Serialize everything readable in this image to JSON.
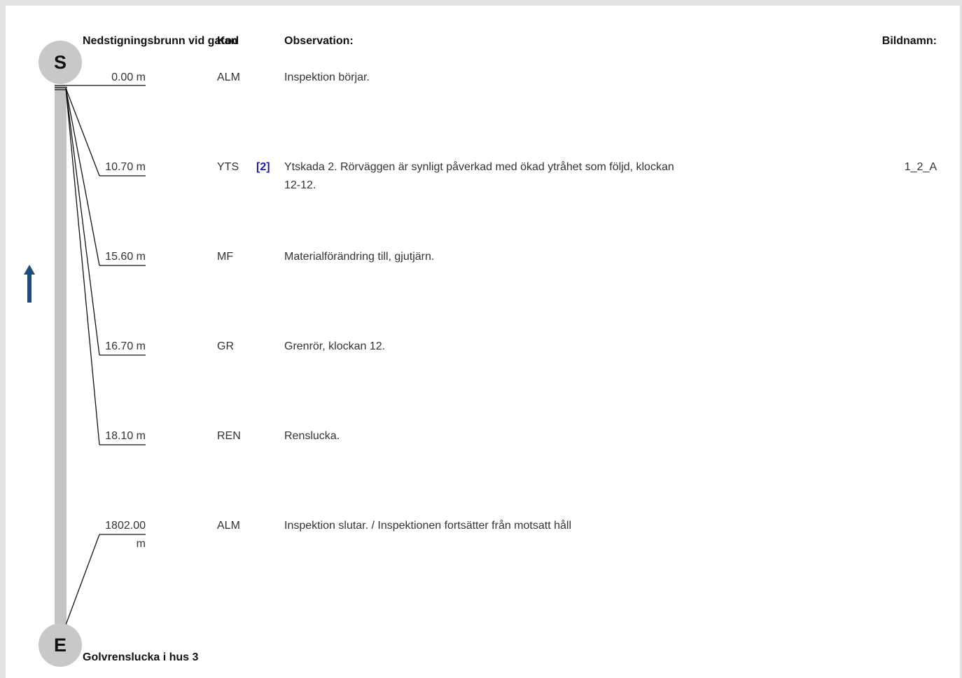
{
  "header": {
    "start_manhole": "Nedstigningsbrunn vid gatan",
    "code": "Kod",
    "observation": "Observation:",
    "image_name": "Bildnamn:"
  },
  "nodes": {
    "start_label": "S",
    "end_label": "E",
    "end_name": "Golvrenslucka i hus 3"
  },
  "rows": [
    {
      "distance": "0.00 m",
      "code": "ALM",
      "grade": "",
      "observation": "Inspektion börjar.",
      "image": "",
      "link": false
    },
    {
      "distance": "10.70 m",
      "code": "YTS",
      "grade": "[2]",
      "observation": "Ytskada 2. Rörväggen är synligt påverkad med ökad ytråhet som följd, klockan 12-12.",
      "image": "1_2_A",
      "link": true
    },
    {
      "distance": "15.60 m",
      "code": "MF",
      "grade": "",
      "observation": "Materialförändring till, gjutjärn.",
      "image": "",
      "link": false
    },
    {
      "distance": "16.70 m",
      "code": "GR",
      "grade": "",
      "observation": "Grenrör, klockan 12.",
      "image": "",
      "link": false
    },
    {
      "distance": "18.10 m",
      "code": "REN",
      "grade": "",
      "observation": "Renslucka.",
      "image": "",
      "link": false
    },
    {
      "distance": "1802.00 m",
      "code": "ALM",
      "grade": "",
      "observation": "Inspektion slutar. / Inspektionen fortsätter från motsatt håll",
      "image": "",
      "link": false
    }
  ],
  "colors": {
    "link": "#1a1aa6",
    "pipe": "#c3c3c3",
    "node": "#c8c8c8",
    "arrow": "#1e4b7a"
  },
  "icons": {
    "flow_direction": "arrow-up-icon"
  }
}
